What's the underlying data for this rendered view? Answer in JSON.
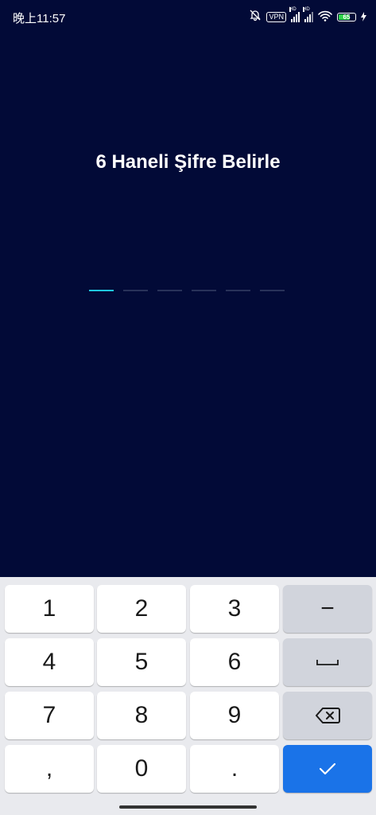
{
  "status_bar": {
    "time": "晚上11:57",
    "vpn": "VPN",
    "hd1": "HD",
    "hd2": "HD",
    "battery": "65",
    "icons": [
      "mute-bell-icon",
      "vpn-icon",
      "signal-icon",
      "signal-icon",
      "wifi-icon",
      "battery-icon",
      "charging-icon"
    ]
  },
  "title": "6 Haneli Şifre Belirle",
  "pin": {
    "length": 6,
    "filled": 0
  },
  "keypad": {
    "keys": [
      "1",
      "2",
      "3",
      "4",
      "5",
      "6",
      "7",
      "8",
      "9",
      ",",
      "0",
      "."
    ],
    "func_icons": [
      "minus-icon",
      "space-icon",
      "backspace-icon",
      "checkmark-icon"
    ],
    "minus": "−"
  },
  "colors": {
    "background": "#020a37",
    "active_slot": "#1fc7de",
    "confirm": "#1a73e8"
  }
}
